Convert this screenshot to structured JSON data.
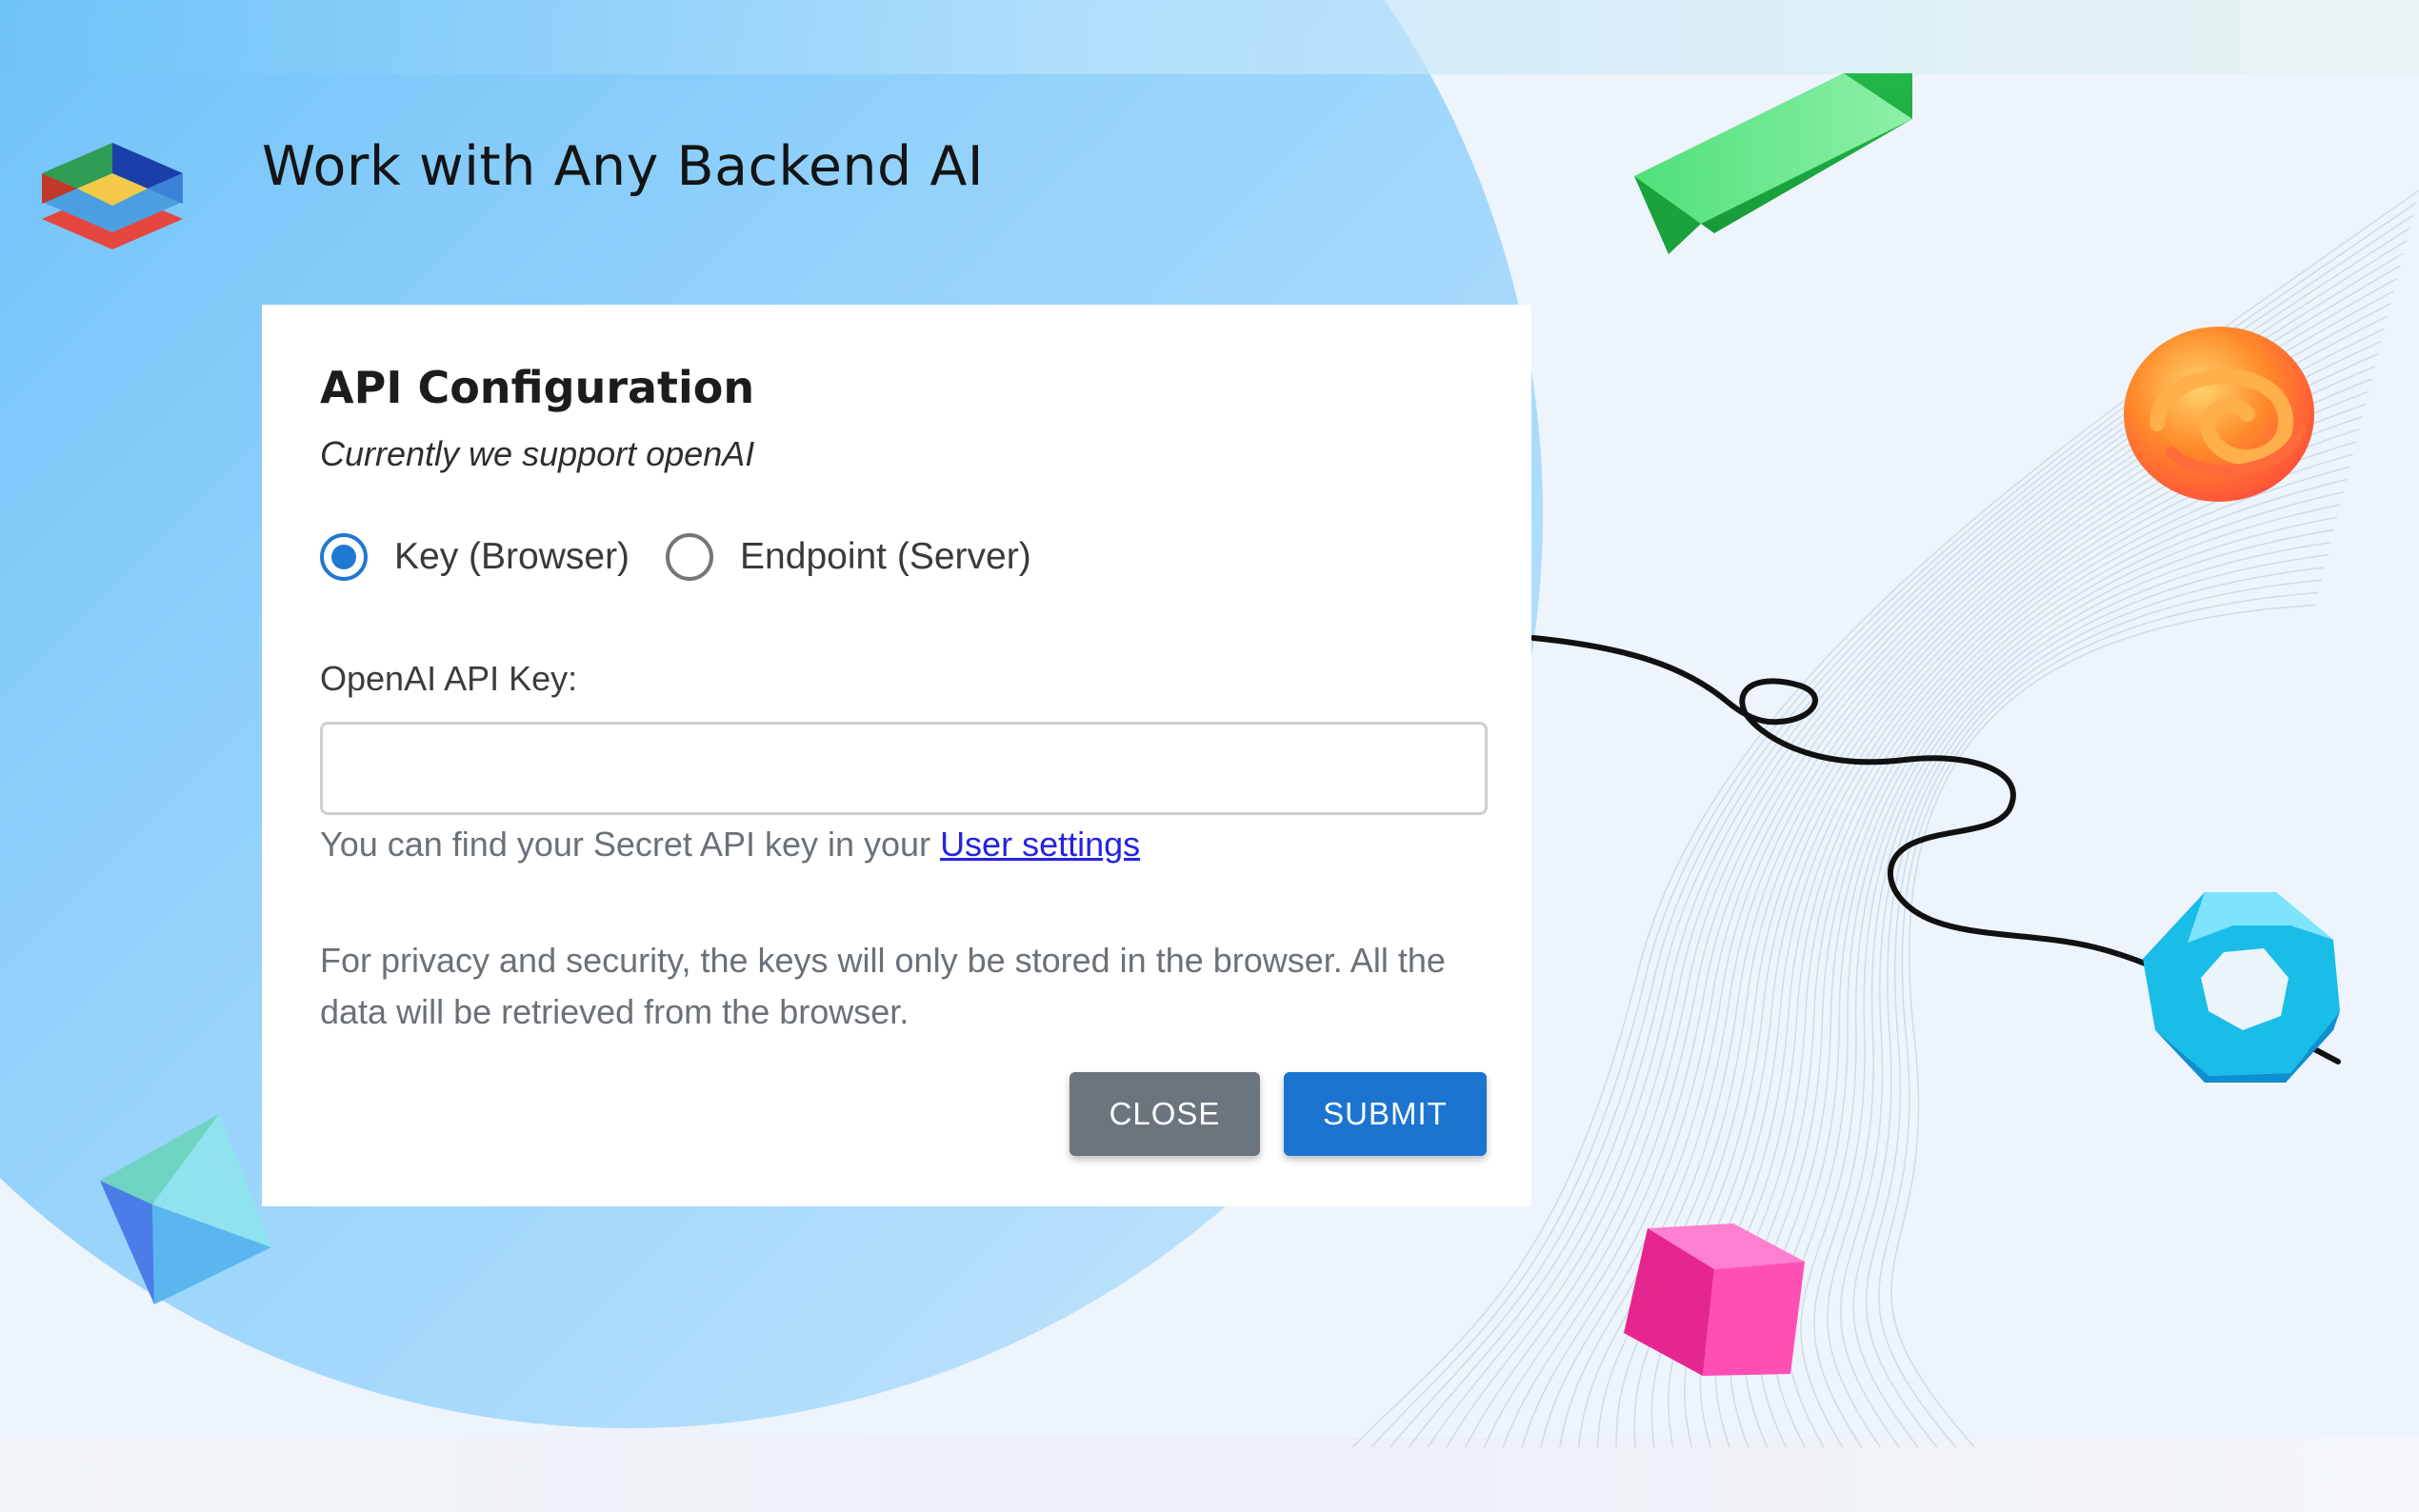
{
  "headline": "Work with Any Backend AI",
  "dialog": {
    "title": "API Configuration",
    "subtitle": "Currently we support openAI",
    "mode_options": [
      {
        "label": "Key (Browser)",
        "selected": true
      },
      {
        "label": "Endpoint (Server)",
        "selected": false
      }
    ],
    "key_field": {
      "label": "OpenAI API Key:",
      "value": ""
    },
    "helper": {
      "text": "You can find your Secret API key in your",
      "link_text": "User settings"
    },
    "privacy_note": "For privacy and security, the keys will only be stored in the browser. All the data will be retrieved from the browser.",
    "buttons": {
      "close": "CLOSE",
      "submit": "SUBMIT"
    }
  },
  "colors": {
    "accent": "#1b75d0",
    "close_button": "#6c757d",
    "link": "#2424e0",
    "background_blob": "#7cc7f9"
  },
  "icons": [
    "layers-logo-icon",
    "green-bar-shape",
    "orange-knot-shape",
    "black-curve-line",
    "blue-ring-shape",
    "octahedron-shape",
    "pink-cube-shape"
  ]
}
